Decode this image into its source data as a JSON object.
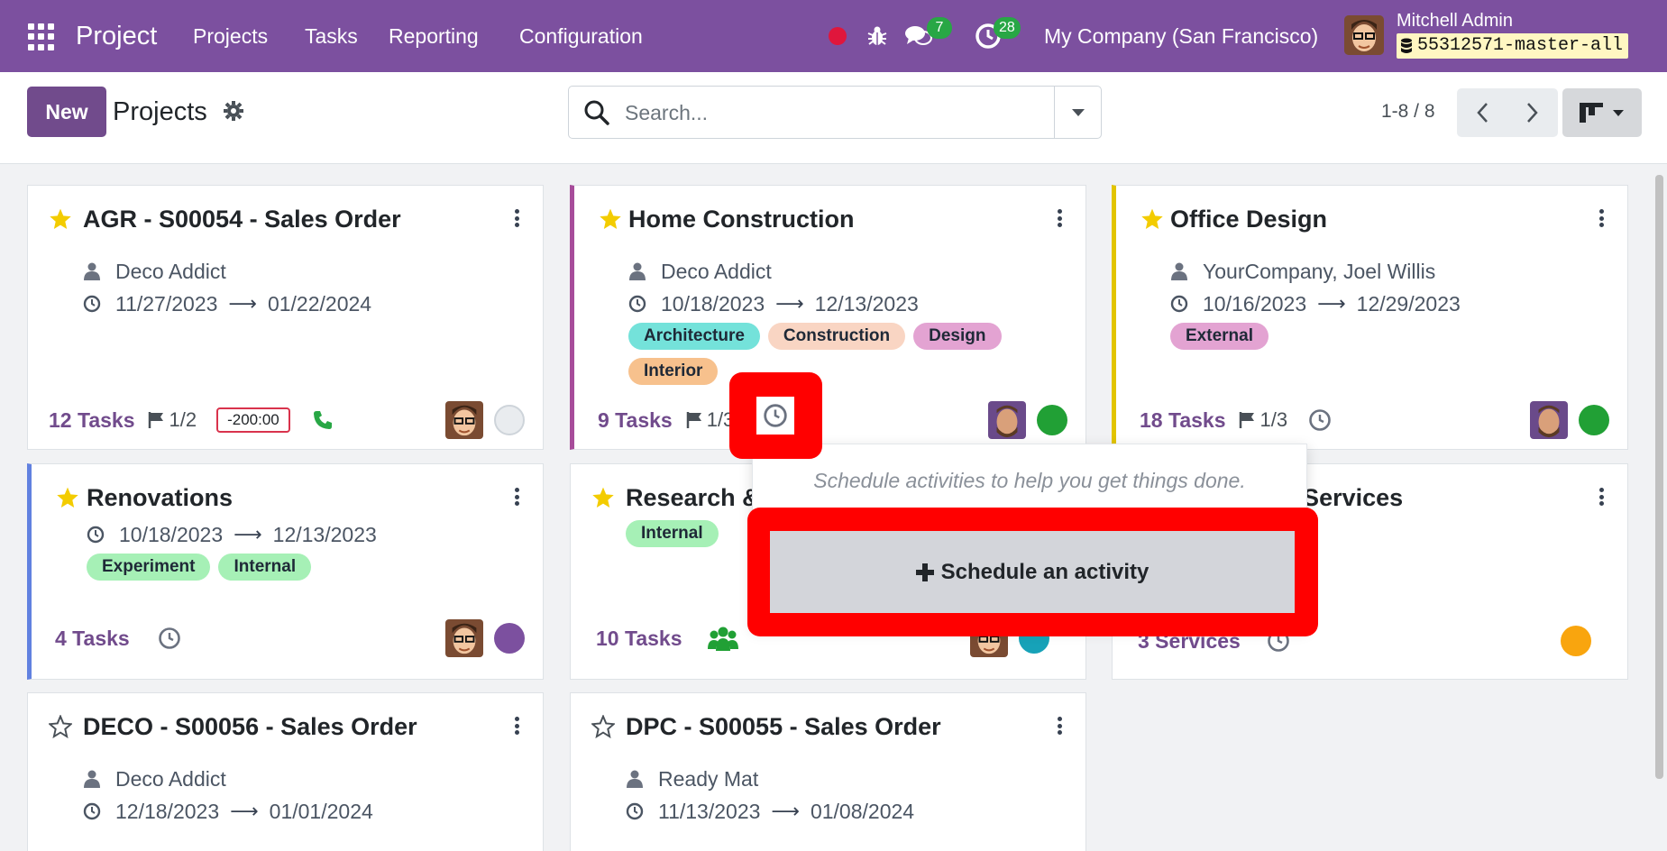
{
  "navbar": {
    "app_name": "Project",
    "menu": [
      "Projects",
      "Tasks",
      "Reporting",
      "Configuration"
    ],
    "messages_count": "7",
    "activities_count": "28",
    "company": "My Company (San Francisco)",
    "user_name": "Mitchell Admin",
    "database": "55312571-master-all",
    "colors": {
      "navbar": "#7c509f",
      "badge": "#28a745"
    }
  },
  "control": {
    "new_label": "New",
    "title": "Projects",
    "search_placeholder": "Search...",
    "pager": "1-8 / 8"
  },
  "cards": [
    {
      "title": "AGR - S00054 - Sales Order",
      "favorite": true,
      "customer": "Deco Addict",
      "date_start": "11/27/2023",
      "date_end": "01/22/2024",
      "tags": [],
      "tasks": "12 Tasks",
      "milestones": "1/2",
      "overdue_hours": "-200:00",
      "activity_icon": "phone-icon",
      "status_color": "#e9ecef"
    },
    {
      "title": "Home Construction",
      "favorite": true,
      "customer": "Deco Addict",
      "date_start": "10/18/2023",
      "date_end": "12/13/2023",
      "tags": [
        {
          "label": "Architecture",
          "color": "#74e2da"
        },
        {
          "label": "Construction",
          "color": "#f9d5c3"
        },
        {
          "label": "Design",
          "color": "#e3a3d2"
        },
        {
          "label": "Interior",
          "color": "#f7c18d"
        }
      ],
      "tasks": "9 Tasks",
      "milestones": "1/3",
      "activity_icon": "clock-icon",
      "status_color": "#21a035"
    },
    {
      "title": "Office Design",
      "favorite": true,
      "customer": "YourCompany, Joel Willis",
      "date_start": "10/16/2023",
      "date_end": "12/29/2023",
      "tags": [
        {
          "label": "External",
          "color": "#e3a3d2"
        }
      ],
      "tasks": "18 Tasks",
      "milestones": "1/3",
      "activity_icon": "clock-icon",
      "status_color": "#21a035"
    },
    {
      "title": "Renovations",
      "favorite": true,
      "date_start": "10/18/2023",
      "date_end": "12/13/2023",
      "tags": [
        {
          "label": "Experiment",
          "color": "#a6f0b6"
        },
        {
          "label": "Internal",
          "color": "#a6f0b6"
        }
      ],
      "tasks": "4 Tasks",
      "activity_icon": "clock-icon",
      "status_color": "#7c509f"
    },
    {
      "title": "Research & Development",
      "favorite": true,
      "tags": [
        {
          "label": "Internal",
          "color": "#a6f0b6"
        }
      ],
      "tasks": "10 Tasks",
      "activity_icon": "users-icon",
      "status_color": "#17a2b8"
    },
    {
      "title": "After-Sales Services",
      "favorite": false,
      "tasks": "3 Services",
      "activity_icon": "clock-icon",
      "status_color": "#f9a50e"
    },
    {
      "title": "DECO - S00056 - Sales Order",
      "favorite": false,
      "customer": "Deco Addict",
      "date_start": "12/18/2023",
      "date_end": "01/01/2024"
    },
    {
      "title": "DPC - S00055 - Sales Order",
      "favorite": false,
      "customer": "Ready Mat",
      "date_start": "11/13/2023",
      "date_end": "01/08/2024"
    }
  ],
  "popover": {
    "hint": "Schedule activities to help you get things done.",
    "button_label": "Schedule an activity"
  }
}
